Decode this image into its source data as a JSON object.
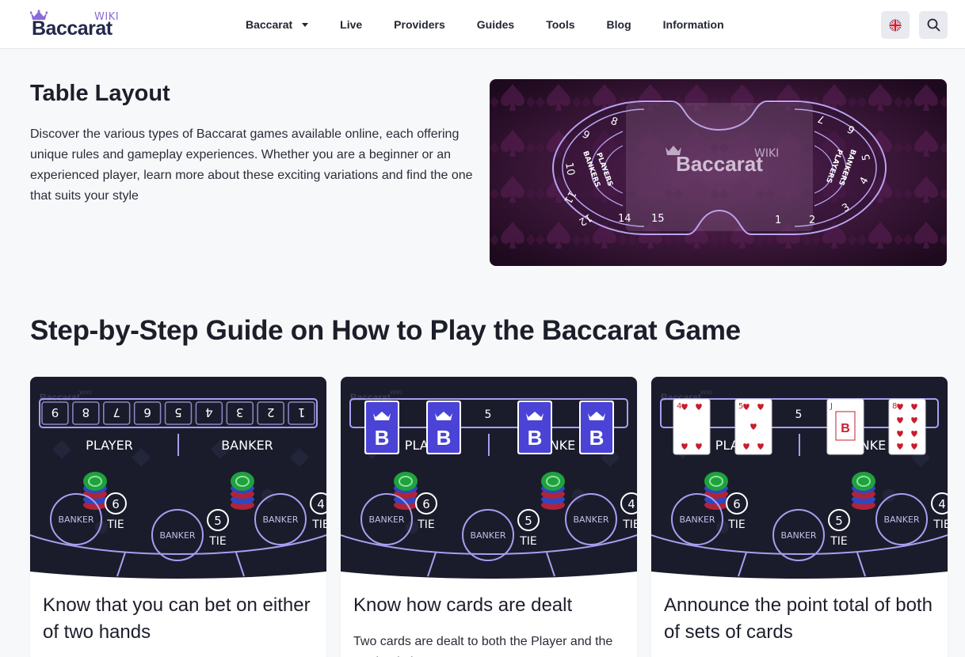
{
  "header": {
    "logo": {
      "wiki": "WIKI",
      "brand": "Baccarat"
    },
    "nav": [
      {
        "label": "Baccarat",
        "has_dropdown": true
      },
      {
        "label": "Live"
      },
      {
        "label": "Providers"
      },
      {
        "label": "Guides"
      },
      {
        "label": "Tools"
      },
      {
        "label": "Blog"
      },
      {
        "label": "Information"
      }
    ],
    "lang_icon": "uk-flag-icon",
    "search_icon": "search-icon"
  },
  "layout_section": {
    "title": "Table Layout",
    "description": "Discover the various types of Baccarat games available online, each offering unique rules and gameplay experiences. Whether you are a beginner or an experienced player, learn more about these exciting variations and find the one that suits your style",
    "image": {
      "logo_wiki": "WIKI",
      "logo_brand": "Baccarat",
      "left_seats": [
        "8",
        "9",
        "10",
        "11",
        "12",
        "14",
        "15"
      ],
      "right_seats": [
        "7",
        "6",
        "5",
        "4",
        "3",
        "2",
        "1"
      ],
      "left_ring": [
        "BANKERS",
        "PLAYERS"
      ],
      "right_ring": [
        "PLAYERS",
        "BANKERS"
      ]
    }
  },
  "guide_section": {
    "title": "Step-by-Step Guide on How to Play the Baccarat Game",
    "cards": [
      {
        "title": "Know that you can bet on either of two hands",
        "text": "",
        "image": {
          "logo_wiki": "WIKI",
          "logo_brand": "Baccarat",
          "numbers": [
            "9",
            "8",
            "7",
            "6",
            "5",
            "4",
            "3",
            "2",
            "1"
          ],
          "player": "PLAYER",
          "banker": "BANKER",
          "spots": [
            "BANKER",
            "BANKER",
            "BANKER"
          ],
          "tie_nums": [
            "6",
            "5",
            "4"
          ],
          "tie": "TIE"
        }
      },
      {
        "title": "Know how cards are dealt",
        "text": "Two cards are dealt to both the Player and the Banker in baccarat.",
        "image": {
          "logo_wiki": "WIKI",
          "logo_brand": "Baccarat",
          "card_letter": "B",
          "visible_number": "5",
          "player_fragment": "PLAY",
          "banker_fragment": "NKE",
          "spots": [
            "BANKER",
            "BANKER",
            "BANKER"
          ],
          "tie_nums": [
            "6",
            "5",
            "4"
          ],
          "tie": "TIE"
        }
      },
      {
        "title": "Announce the point total of both of sets of cards",
        "text": "",
        "image": {
          "logo_wiki": "WIKI",
          "logo_brand": "Baccarat",
          "visible_number": "5",
          "player_fragment": "PLAY",
          "banker_fragment": "NKE",
          "card_ranks": [
            "4",
            "5",
            "J",
            "8"
          ],
          "spots": [
            "BANKER",
            "BANKER",
            "BANKER"
          ],
          "tie_nums": [
            "6",
            "5",
            "4"
          ],
          "tie": "TIE"
        }
      }
    ]
  },
  "colors": {
    "brand_dark": "#24284a",
    "brand_purple": "#8a6ad8",
    "card_blue": "#4a43d6",
    "table_bg": "#1a1c2b",
    "felt_purple": "#3a1638"
  }
}
